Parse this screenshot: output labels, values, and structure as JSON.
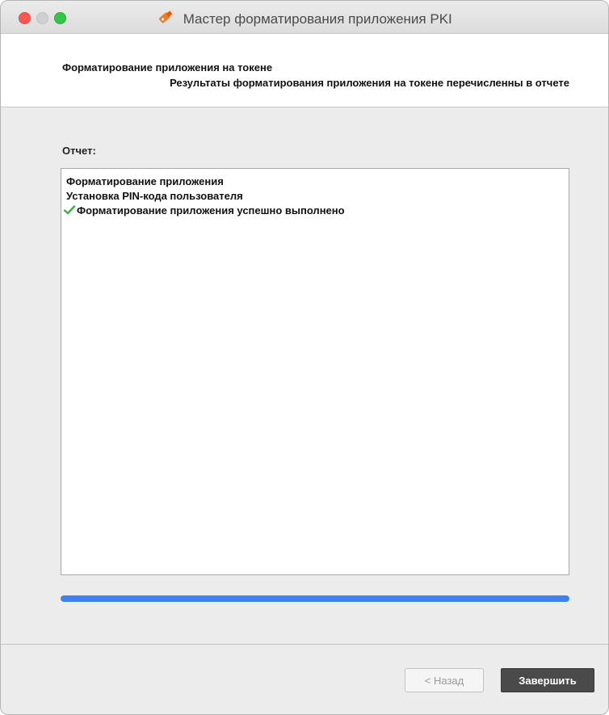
{
  "window": {
    "title": "Мастер форматирования приложения PKI",
    "icon": "key-icon"
  },
  "header": {
    "title": "Форматирование приложения на токене",
    "subtitle": "Результаты форматирования приложения на токене перечисленны в отчете"
  },
  "report": {
    "label": "Отчет:",
    "lines": [
      "Форматирование приложения",
      "Установка PIN-кода пользователя",
      "Форматирование приложения успешно выполнено"
    ]
  },
  "progress": {
    "value_percent": 100,
    "color": "#3b82f0"
  },
  "buttons": {
    "back_label": "< Назад",
    "finish_label": "Завершить"
  }
}
